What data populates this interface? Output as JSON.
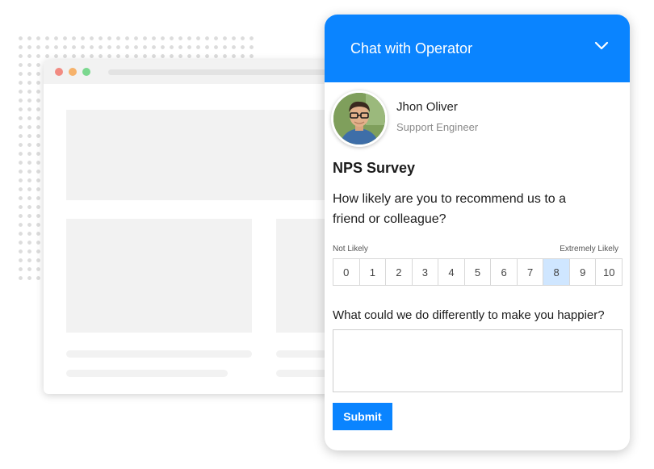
{
  "widget": {
    "title": "Chat with Operator"
  },
  "operator": {
    "name": "Jhon Oliver",
    "role": "Support Engineer"
  },
  "survey": {
    "title": "NPS Survey",
    "question": "How likely are you to recommend us to a friend or colleague?",
    "scale_low_label": "Not Likely",
    "scale_high_label": "Extremely Likely",
    "scale": [
      "0",
      "1",
      "2",
      "3",
      "4",
      "5",
      "6",
      "7",
      "8",
      "9",
      "10"
    ],
    "selected": "8",
    "followup_question": "What could we do differently to make you happier?",
    "followup_value": "",
    "submit_label": "Submit"
  },
  "colors": {
    "accent": "#0a84ff",
    "selected_cell": "#cfe6ff"
  },
  "icons": {
    "collapse": "chevron-down-icon"
  }
}
